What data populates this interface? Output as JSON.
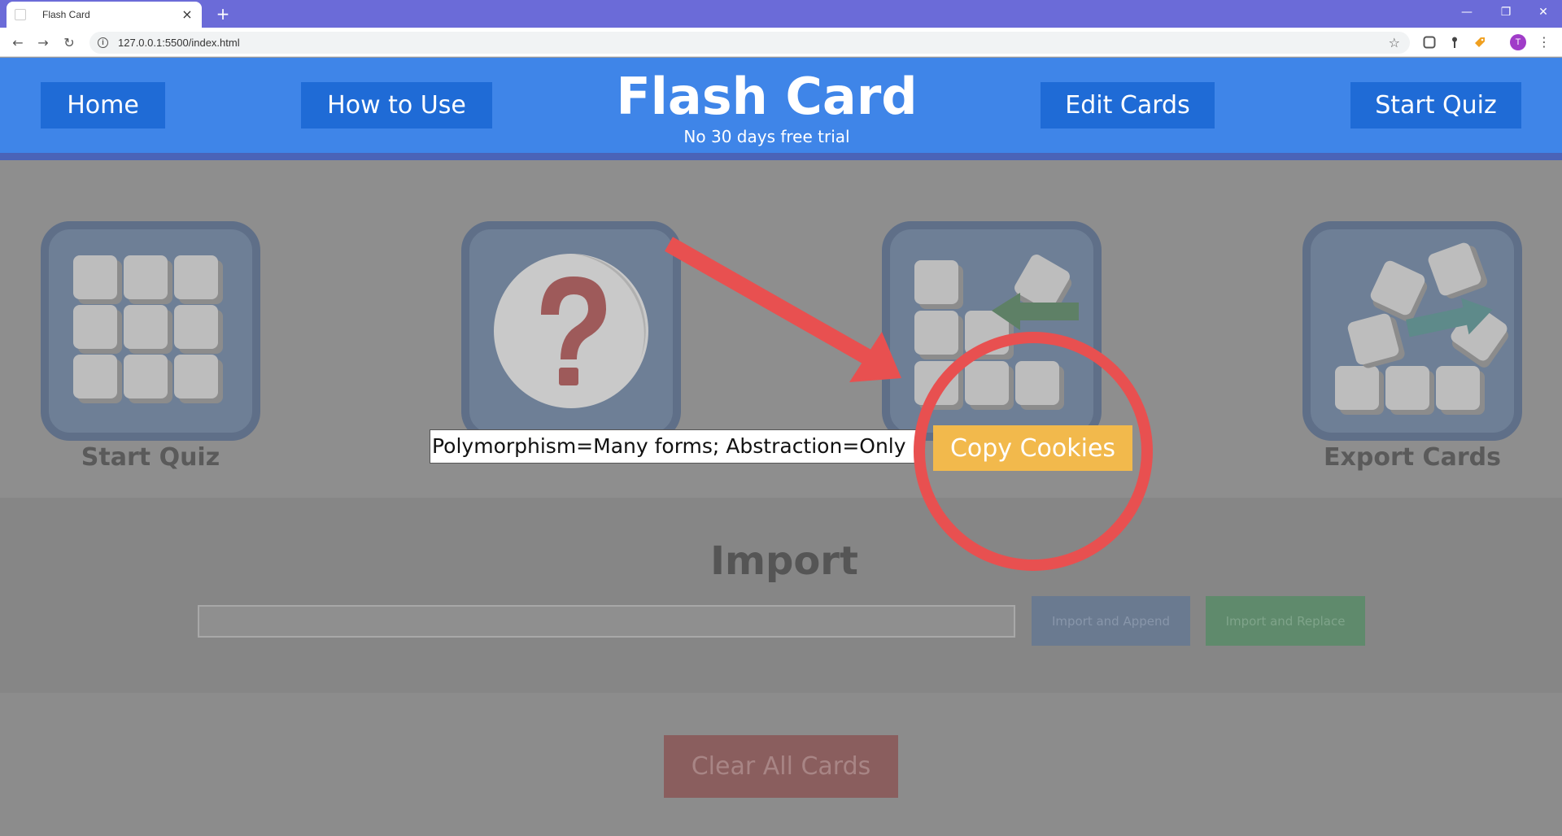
{
  "browser": {
    "tab_title": "Flash Card",
    "tab_close": "×",
    "new_tab": "+",
    "url": "127.0.0.1:5500/index.html",
    "avatar_letter": "T",
    "window_controls": {
      "minimize": "—",
      "restore": "❐",
      "close": "✕"
    },
    "nav": {
      "back": "←",
      "forward": "→",
      "reload": "↻"
    }
  },
  "header": {
    "brand_title": "Flash Card",
    "brand_subtitle": "No 30 days free trial",
    "nav": {
      "home": "Home",
      "how_to_use": "How to Use",
      "edit_cards": "Edit Cards",
      "start_quiz": "Start Quiz"
    }
  },
  "tiles": {
    "start_quiz": "Start Quiz",
    "export_cards": "Export Cards"
  },
  "import": {
    "title": "Import",
    "input_value": "",
    "append_label": "Import and Append",
    "replace_label": "Import and Replace"
  },
  "clear": {
    "label": "Clear All Cards"
  },
  "overlay": {
    "cookie_text": "Polymorphism=Many forms; Abstraction=Only",
    "copy_label": "Copy Cookies"
  },
  "colors": {
    "header": "#3f85e8",
    "nav_button": "#1f6bd6",
    "copy_button": "#f2b94c",
    "annotation": "#e85050"
  }
}
